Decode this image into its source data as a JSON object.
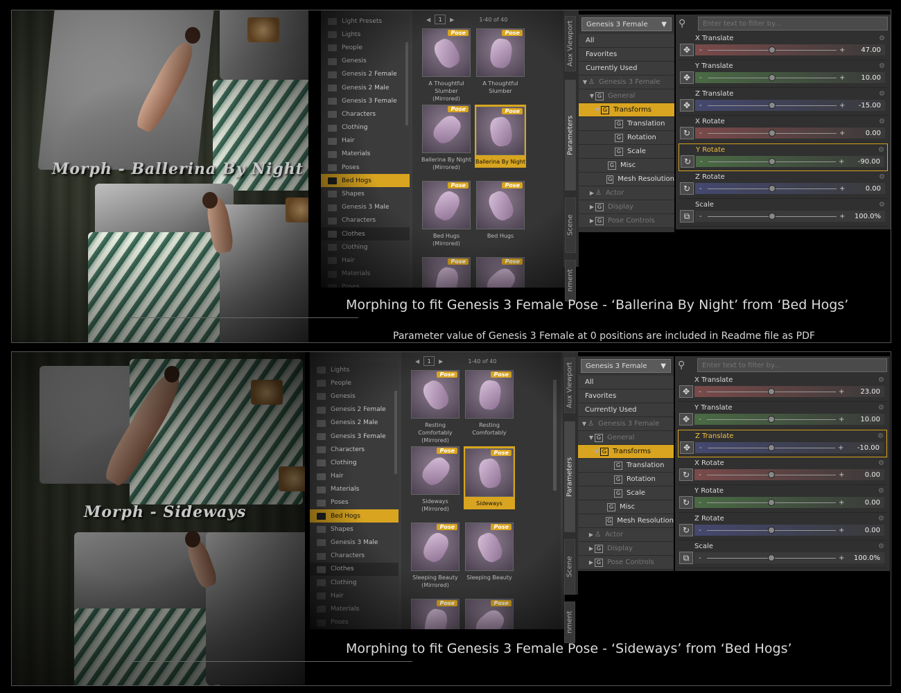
{
  "panels": [
    {
      "morph_label": "Morph - Ballerina By Night",
      "caption": "Morphing to fit Genesis 3 Female Pose - ‘Ballerina By Night’ from ‘Bed Hogs’",
      "subcaption": "Parameter value of Genesis 3 Female at 0 positions are included in Readme file as PDF",
      "library": {
        "tree": [
          "Light Presets",
          "Lights",
          "People",
          "Genesis",
          "Genesis 2 Female",
          "Genesis 2 Male",
          "Genesis 3 Female",
          "Characters",
          "Clothing",
          "Hair",
          "Materials",
          "Poses",
          "Bed Hogs",
          "Shapes",
          "Genesis 3 Male",
          "Characters",
          "Clothes",
          "Clothing",
          "Hair",
          "Materials",
          "Poses"
        ],
        "page": "1",
        "count": "1-40 of 40",
        "cards": [
          {
            "name": "A Thoughtful Slumber (Mirrored)",
            "tag": "Pose"
          },
          {
            "name": "A Thoughtful Slumber",
            "tag": "Pose"
          },
          {
            "name": "Ballerina By Night (Mirrored)",
            "tag": "Pose"
          },
          {
            "name": "Ballerina By Night",
            "tag": "Pose"
          },
          {
            "name": "Bed Hugs (Mirrored)",
            "tag": "Pose"
          },
          {
            "name": "Bed Hugs",
            "tag": "Pose"
          },
          {
            "name": "",
            "tag": "Pose"
          },
          {
            "name": "",
            "tag": "Pose"
          }
        ]
      },
      "tabs": [
        "Aux Viewport",
        "Parameters",
        "Scene",
        "nment"
      ],
      "figure_select": "Genesis 3 Female",
      "ptree": [
        "All",
        "Favorites",
        "Currently Used",
        "Genesis 3 Female",
        "General",
        "Transforms",
        "Translation",
        "Rotation",
        "Scale",
        "Misc",
        "Mesh Resolution",
        "Actor",
        "Display",
        "Pose Controls"
      ],
      "filter_placeholder": "Enter text to filter by...",
      "params": [
        {
          "label": "X Translate",
          "value": "47.00",
          "pos": 0.5
        },
        {
          "label": "Y Translate",
          "value": "10.00",
          "pos": 0.5
        },
        {
          "label": "Z Translate",
          "value": "-15.00",
          "pos": 0.5
        },
        {
          "label": "X Rotate",
          "value": "0.00",
          "pos": 0.5
        },
        {
          "label": "Y Rotate",
          "value": "-90.00",
          "pos": 0.5
        },
        {
          "label": "Z Rotate",
          "value": "0.00",
          "pos": 0.5
        },
        {
          "label": "Scale",
          "value": "100.0%",
          "pos": 0.5
        }
      ]
    },
    {
      "morph_label": "Morph - Sideways",
      "caption": "Morphing to fit Genesis 3 Female Pose - ‘Sideways’ from ‘Bed Hogs’",
      "library": {
        "tree": [
          "Lights",
          "People",
          "Genesis",
          "Genesis 2 Female",
          "Genesis 2 Male",
          "Genesis 3 Female",
          "Characters",
          "Clothing",
          "Hair",
          "Materials",
          "Poses",
          "Bed Hogs",
          "Shapes",
          "Genesis 3 Male",
          "Characters",
          "Clothes",
          "Clothing",
          "Hair",
          "Materials",
          "Poses"
        ],
        "page": "1",
        "count": "1-40 of 40",
        "cards": [
          {
            "name": "Resting Comfortably (Mirrored)",
            "tag": "Pose"
          },
          {
            "name": "Resting Comfortably",
            "tag": "Pose"
          },
          {
            "name": "Sideways (Mirrored)",
            "tag": "Pose"
          },
          {
            "name": "Sideways",
            "tag": "Pose"
          },
          {
            "name": "Sleeping Beauty (Mirrored)",
            "tag": "Pose"
          },
          {
            "name": "Sleeping Beauty",
            "tag": "Pose"
          },
          {
            "name": "",
            "tag": "Pose"
          },
          {
            "name": "",
            "tag": "Pose"
          }
        ]
      },
      "tabs": [
        "Aux Viewport",
        "Parameters",
        "Scene",
        "nment"
      ],
      "figure_select": "Genesis 3 Female",
      "ptree": [
        "All",
        "Favorites",
        "Currently Used",
        "Genesis 3 Female",
        "General",
        "Transforms",
        "Translation",
        "Rotation",
        "Scale",
        "Misc",
        "Mesh Resolution",
        "Actor",
        "Display",
        "Pose Controls"
      ],
      "filter_placeholder": "Enter text to filter by...",
      "params": [
        {
          "label": "X Translate",
          "value": "23.00",
          "pos": 0.5
        },
        {
          "label": "Y Translate",
          "value": "10.00",
          "pos": 0.5
        },
        {
          "label": "Z Translate",
          "value": "-10.00",
          "pos": 0.5
        },
        {
          "label": "X Rotate",
          "value": "0.00",
          "pos": 0.5
        },
        {
          "label": "Y Rotate",
          "value": "0.00",
          "pos": 0.5
        },
        {
          "label": "Z Rotate",
          "value": "0.00",
          "pos": 0.5
        },
        {
          "label": "Scale",
          "value": "100.0%",
          "pos": 0.5
        }
      ]
    }
  ],
  "colors": {
    "accent": "#d9a520",
    "x_axis": "#7a4a4a",
    "y_axis": "#4a6a44",
    "z_axis": "#44486e"
  }
}
